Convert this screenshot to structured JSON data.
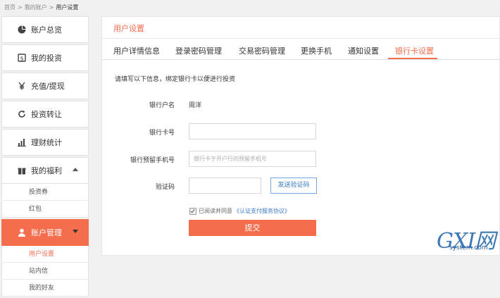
{
  "breadcrumb": [
    "首页",
    "我的账户",
    "用户设置"
  ],
  "breadcrumb_sep": ">",
  "sidebar": {
    "items": [
      {
        "label": "账户总览",
        "icon": "pie-chart-icon"
      },
      {
        "label": "我的投资",
        "icon": "investment-icon"
      },
      {
        "label": "充值/提现",
        "icon": "yen-icon"
      },
      {
        "label": "投资转让",
        "icon": "refresh-icon"
      },
      {
        "label": "理财统计",
        "icon": "bar-chart-icon"
      },
      {
        "label": "我的福利",
        "icon": "gift-icon"
      }
    ],
    "welfare_sub": [
      "投资券",
      "红包"
    ],
    "account_mgmt": {
      "label": "账户管理",
      "icon": "user-icon"
    },
    "account_sub": [
      "用户设置",
      "站内信",
      "我的好友"
    ]
  },
  "main": {
    "title": "用户设置",
    "tabs": [
      "用户详情信息",
      "登录密码管理",
      "交易密码管理",
      "更换手机",
      "通知设置",
      "银行卡设置"
    ],
    "active_tab": "银行卡设置",
    "intro": "请填写以下信息，绑定银行卡以便进行投资",
    "form": {
      "holder_label": "银行户名",
      "holder_value": "周洋",
      "card_label": "银行卡号",
      "card_value": "",
      "phone_label": "银行预留手机号",
      "phone_placeholder": "银行卡于开户行的预留手机号",
      "code_label": "验证码",
      "code_value": "",
      "send_code": "发送验证码",
      "agree_text": "已阅读并同意",
      "agree_link": "《认证支付服务协议》",
      "submit": "提交"
    }
  },
  "watermark": {
    "big": "GXI网",
    "small": "system.com"
  },
  "colors": {
    "accent": "#f46d4d",
    "link": "#3a7bc8"
  }
}
